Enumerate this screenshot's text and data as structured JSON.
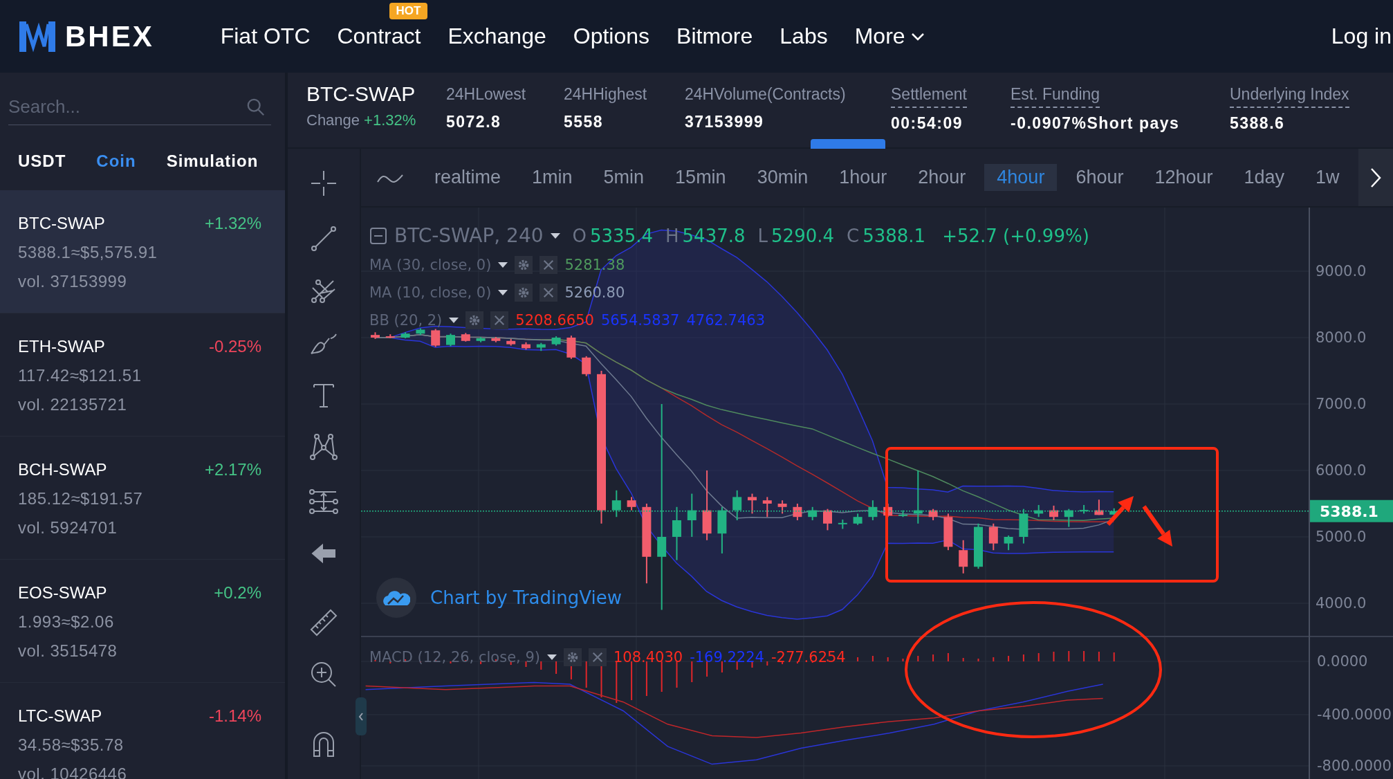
{
  "header": {
    "brand": "BHEX",
    "nav": [
      {
        "label": "Fiat OTC"
      },
      {
        "label": "Contract",
        "badge": "HOT"
      },
      {
        "label": "Exchange"
      },
      {
        "label": "Options"
      },
      {
        "label": "Bitmore"
      },
      {
        "label": "Labs"
      },
      {
        "label": "More",
        "dropdown": true
      }
    ],
    "login": "Log in"
  },
  "sidebar": {
    "search": {
      "placeholder": "Search..."
    },
    "tabs": [
      {
        "label": "USDT",
        "selected": false
      },
      {
        "label": "Coin",
        "selected": true
      },
      {
        "label": "Simulation",
        "selected": false
      }
    ]
  },
  "markets": [
    {
      "symbol": "BTC-SWAP",
      "change": "+1.32%",
      "color": "#45c486",
      "price": "5388.1≈$5,575.91",
      "volume": "vol. 37153999",
      "selected": true
    },
    {
      "symbol": "ETH-SWAP",
      "change": "-0.25%",
      "color": "#f0455b",
      "price": "117.42≈$121.51",
      "volume": "vol. 22135721",
      "selected": false
    },
    {
      "symbol": "BCH-SWAP",
      "change": "+2.17%",
      "color": "#45c486",
      "price": "185.12≈$191.57",
      "volume": "vol. 5924701",
      "selected": false
    },
    {
      "symbol": "EOS-SWAP",
      "change": "+0.2%",
      "color": "#45c486",
      "price": "1.993≈$2.06",
      "volume": "vol. 3515478",
      "selected": false
    },
    {
      "symbol": "LTC-SWAP",
      "change": "-1.14%",
      "color": "#f0455b",
      "price": "34.58≈$35.78",
      "volume": "vol. 10426446",
      "selected": false
    }
  ],
  "ticker": {
    "symbol": "BTC-SWAP",
    "change_label": "Change",
    "change": "+1.32%",
    "stats": [
      {
        "label": "24HLowest",
        "value": "5072.8",
        "dashed": false
      },
      {
        "label": "24HHighest",
        "value": "5558",
        "dashed": false
      },
      {
        "label": "24HVolume(Contracts)",
        "value": "37153999",
        "dashed": false
      },
      {
        "label": "Settlement",
        "value": "00:54:09",
        "dashed": true
      },
      {
        "label": "Est. Funding",
        "value": "-0.0907%Short pays",
        "dashed": true
      },
      {
        "label": "Underlying Index",
        "value": "5388.6",
        "dashed": true
      }
    ]
  },
  "timeframes": [
    {
      "label": "realtime",
      "selected": false
    },
    {
      "label": "1min",
      "selected": false
    },
    {
      "label": "5min",
      "selected": false
    },
    {
      "label": "15min",
      "selected": false
    },
    {
      "label": "30min",
      "selected": false
    },
    {
      "label": "1hour",
      "selected": false
    },
    {
      "label": "2hour",
      "selected": false
    },
    {
      "label": "4hour",
      "selected": true
    },
    {
      "label": "6hour",
      "selected": false
    },
    {
      "label": "12hour",
      "selected": false
    },
    {
      "label": "1day",
      "selected": false
    },
    {
      "label": "1w",
      "selected": false
    }
  ],
  "chart": {
    "legend": {
      "title": "BTC-SWAP, 240",
      "ohlc": [
        {
          "label": "O",
          "value": "5335.4"
        },
        {
          "label": "H",
          "value": "5437.8"
        },
        {
          "label": "L",
          "value": "5290.4"
        },
        {
          "label": "C",
          "value": "5388.1"
        }
      ],
      "change": "+52.7 (+0.99%)"
    },
    "indicators": [
      {
        "name": "MA (30, close, 0)",
        "values": [
          {
            "text": "5281.38",
            "color": "#4f9a5e"
          }
        ]
      },
      {
        "name": "MA (10, close, 0)",
        "values": [
          {
            "text": "5260.80",
            "color": "#8d9bb5"
          }
        ]
      },
      {
        "name": "BB (20, 2)",
        "values": [
          {
            "text": "5208.6650",
            "color": "#ff2a1f"
          },
          {
            "text": "5654.5837",
            "color": "#1a34ff"
          },
          {
            "text": "4762.7463",
            "color": "#1a34ff"
          }
        ]
      }
    ],
    "price_axis": [
      "9000.0",
      "8000.0",
      "7000.0",
      "6000.0",
      "5000.0",
      "4000.0"
    ],
    "last_price": "5388.1",
    "attribution": "Chart by TradingView",
    "macd": {
      "name": "MACD (12, 26, close, 9)",
      "values": [
        {
          "text": "108.4030",
          "color": "#ff2a1f"
        },
        {
          "text": "-169.2224",
          "color": "#1a34ff"
        },
        {
          "text": "-277.6254",
          "color": "#ff2a1f"
        }
      ]
    },
    "macd_axis": [
      "0.0000",
      "-400.0000",
      "-800.0000"
    ]
  }
}
